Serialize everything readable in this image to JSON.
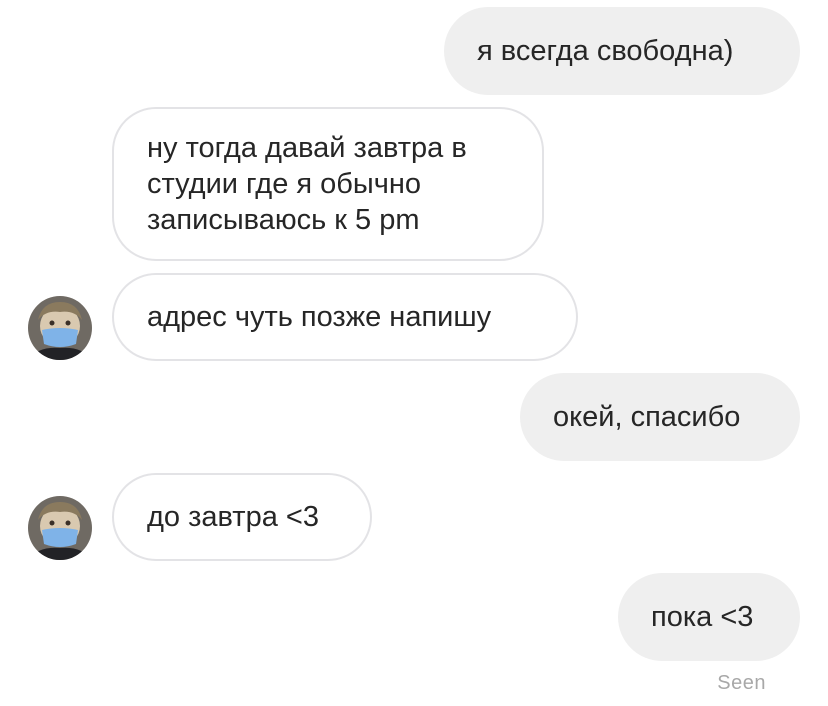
{
  "messages": [
    {
      "direction": "sent",
      "text": "я всегда свободна)"
    },
    {
      "direction": "received",
      "text": "ну тогда давай завтра в\nстудии где я обычно\nзаписываюсь к 5 pm"
    },
    {
      "direction": "received",
      "text": "адрес чуть позже напишу"
    },
    {
      "direction": "sent",
      "text": "окей, спасибо"
    },
    {
      "direction": "received",
      "text": "до завтра <3"
    },
    {
      "direction": "sent",
      "text": "пока <3"
    }
  ],
  "status": {
    "seen": "Seen"
  },
  "colors": {
    "sent_bubble": "#efefef",
    "received_border": "#e3e3e6",
    "text": "#262626",
    "seen_text": "#a8a8a8",
    "mask": "#7fb3e8"
  },
  "icons": {
    "avatar": "user-avatar"
  }
}
